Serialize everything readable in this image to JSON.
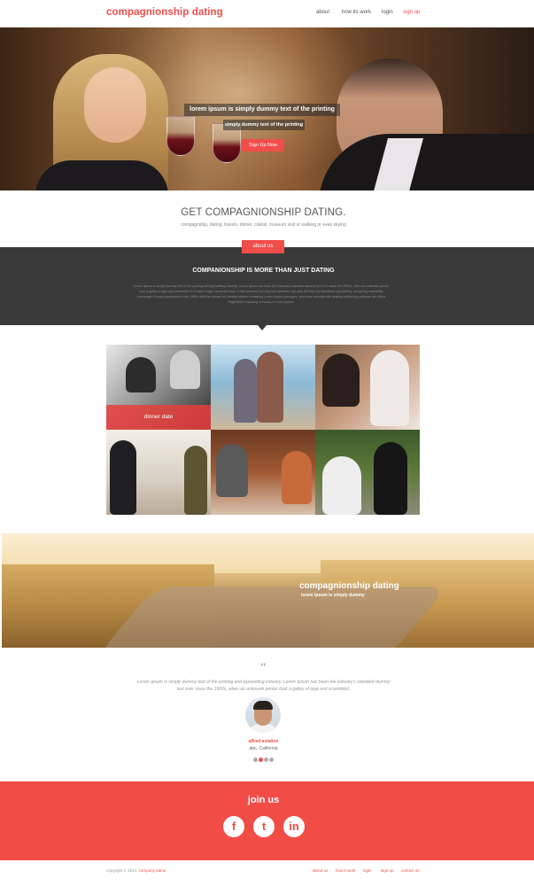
{
  "header": {
    "logo": "compagnionship dating",
    "nav": [
      {
        "label": "about",
        "active": false
      },
      {
        "label": "how its work",
        "active": false
      },
      {
        "label": "login",
        "active": false
      },
      {
        "label": "sign up",
        "active": true
      }
    ]
  },
  "hero": {
    "title": "lorem ipsum is simply dummy text of the printing",
    "subtitle": "simply dummy text of the printing",
    "cta": "Sign Up Now"
  },
  "intro": {
    "title": "GET COMPAGNIONSHIP DATING.",
    "subtitle": "compagnship, dating, travels, dinner, coktail, museum visit or walking or even skying"
  },
  "about": {
    "tab": "about us",
    "heading": "COMPANIONSHIP IS MORE THAN JUST DATING",
    "text": "Lorem Ipsum is simply dummy text of the printing and typesetting industry. Lorem Ipsum has been the industry's standard dummy text ever since the 1500s, when an unknown printer took a galley of type and scrambled it to make a type specimen book. It has survived not only five centuries, but also the leap into electronic typesetting, remaining essentially unchanged. It was popularised in the 1960s with the release of Letraset sheets containing Lorem Ipsum passages, and more recently with desktop publishing software like Aldus PageMaker including versions of Lorem Ipsum."
  },
  "gallery": {
    "caption": "dinner date",
    "tiles": [
      "couple-bw",
      "couple-beach",
      "couple-smile",
      "couple-street",
      "couple-restaurant",
      "couple-formal"
    ]
  },
  "banner": {
    "title": "compagnionship dating",
    "subtitle": "lorem ipsum is simply dummy"
  },
  "testimonial": {
    "quote_mark": "“",
    "text": "Lorem Ipsum is simply dummy text of the printing and typesetting industry. Lorem Ipsum has been the industry's standard dummy text ever since the 1500s, when an unknown printer took a galley of type and scrambled.",
    "name": "alfred aviation",
    "location": "abc, California",
    "active_dot": 1
  },
  "join": {
    "title": "join us",
    "social": [
      {
        "name": "facebook-icon",
        "glyph": "f"
      },
      {
        "name": "twitter-icon",
        "glyph": "t"
      },
      {
        "name": "linkedin-icon",
        "glyph": "in"
      }
    ]
  },
  "footer": {
    "copyright": "copyright © 2014,",
    "company": "company name",
    "links": [
      "about us",
      "how it work",
      "login",
      "sign up",
      "contact us"
    ]
  },
  "colors": {
    "accent": "#f04e4a",
    "dark_band": "#3a3a3a",
    "join_band": "#f24c47"
  }
}
